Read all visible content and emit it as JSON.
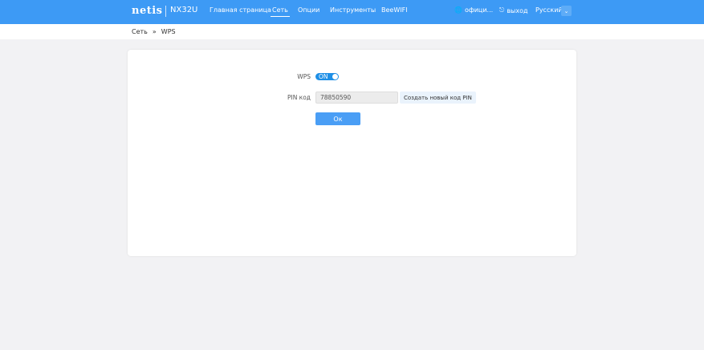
{
  "header": {
    "logo": "netis",
    "model": "NX32U",
    "nav": [
      {
        "label": "Главная страница"
      },
      {
        "label": "Сеть",
        "active": true
      },
      {
        "label": "Опции"
      },
      {
        "label": "Инструменты"
      },
      {
        "label": "BeeWIFI"
      }
    ],
    "official": "офици...",
    "logout": "выход",
    "language": "Русский"
  },
  "breadcrumb": {
    "parent": "Сеть",
    "separator": "»",
    "current": "WPS"
  },
  "form": {
    "wps_label": "WPS",
    "wps_state": "ON",
    "pin_label": "PIN код",
    "pin_value": "78850590",
    "generate_label": "Создать новый код PIN",
    "ok_label": "Ок"
  },
  "colors": {
    "header": "#3d9af5",
    "toggle": "#1e8fe6",
    "ok_button": "#4a9ef5"
  }
}
